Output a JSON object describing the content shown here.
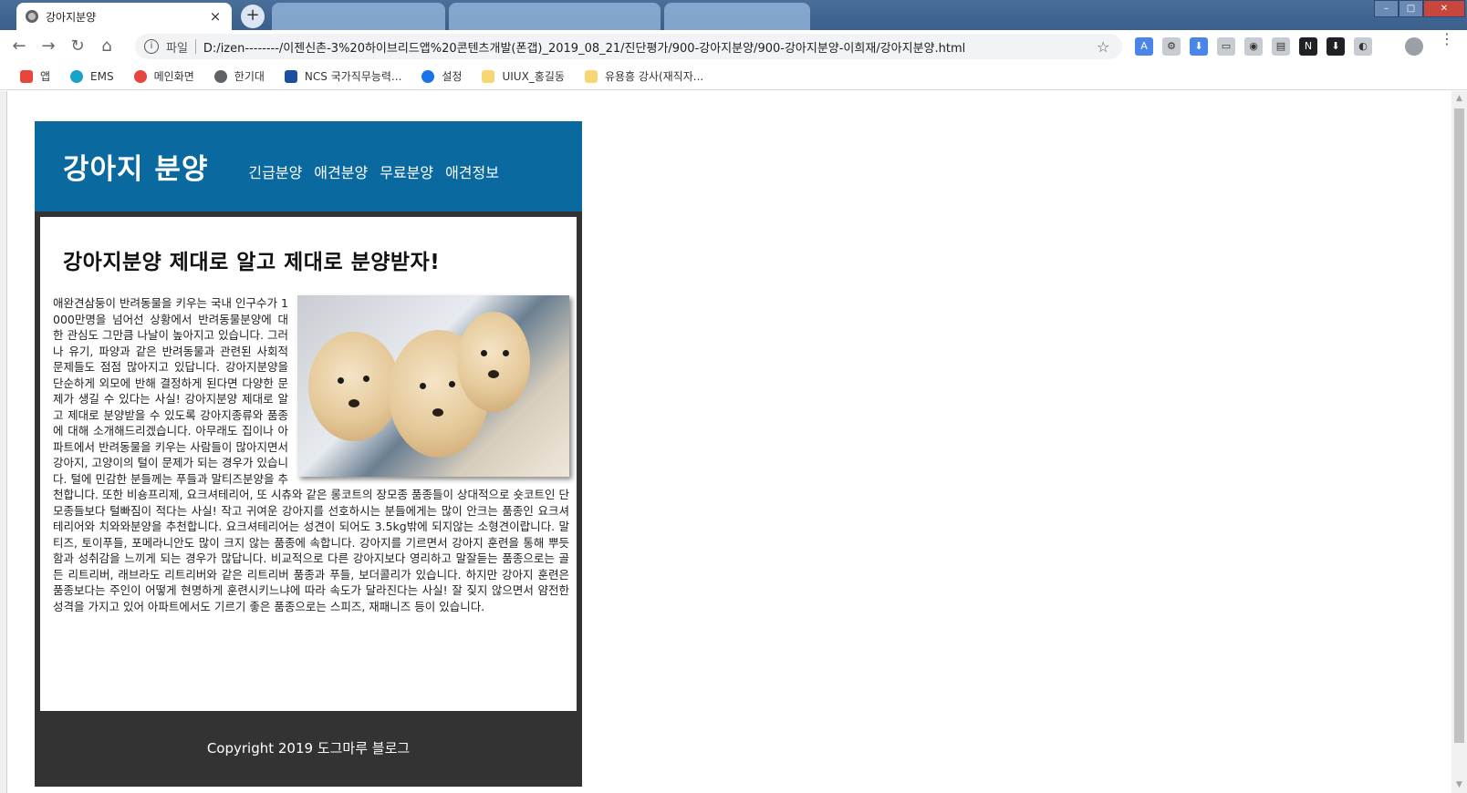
{
  "browser": {
    "active_tab": {
      "title": "강아지분양",
      "close": "×"
    },
    "new_tab": "+",
    "window_controls": {
      "minimize": "–",
      "maximize": "□",
      "close": "✕"
    },
    "nav": {
      "back": "←",
      "forward": "→",
      "reload": "↻",
      "home": "⌂"
    },
    "omnibox": {
      "info": "i",
      "scheme": "파일",
      "url": "D:/izen--------/이젠신촌-3%20하이브리드앱%20콘텐츠개발(폰갭)_2019_08_21/진단평가/900-강아지분양/900-강아지분양-이희재/강아지분양.html",
      "star": "☆"
    },
    "extensions": [
      "A",
      "⚙",
      "⬇",
      "▭",
      "◉",
      "▤",
      "N",
      "⬇",
      "◐"
    ],
    "bookmarks": [
      {
        "label": "앱",
        "icon": "apps-grid-icon",
        "color": "#e8453c"
      },
      {
        "label": "EMS",
        "icon": "ems-icon",
        "color": "#1aa3c9"
      },
      {
        "label": "메인화면",
        "icon": "main-icon",
        "color": "#e8453c"
      },
      {
        "label": "한기대",
        "icon": "globe-icon",
        "color": "#5f6368"
      },
      {
        "label": "NCS 국가직무능력...",
        "icon": "ncs-icon",
        "color": "#1a4fa0"
      },
      {
        "label": "설정",
        "icon": "gear-icon",
        "color": "#1a73e8"
      },
      {
        "label": "UIUX_홍길동",
        "icon": "folder-icon",
        "color": "#f7d774"
      },
      {
        "label": "유용흥 강사(재직자...",
        "icon": "folder-icon",
        "color": "#f7d774"
      }
    ]
  },
  "site": {
    "logo": "강아지 분양",
    "nav": [
      "긴급분양",
      "애견분양",
      "무료분양",
      "애견정보"
    ],
    "article": {
      "title": "강아지분양 제대로 알고 제대로 분양받자!",
      "body": "애완견삼둥이 반려동물을 키우는 국내 인구수가 1000만명을 넘어선 상황에서 반려동물분양에 대한 관심도 그만큼 나날이 높아지고 있습니다. 그러나 유기, 파양과 같은 반려동물과 관련된 사회적 문제들도 점점 많아지고 있답니다. 강아지분양을 단순하게 외모에 반해 결정하게 된다면 다양한 문제가 생길 수 있다는 사실! 강아지분양 제대로 알고 제대로 분양받을 수 있도록 강아지종류와 품종에 대해 소개해드리겠습니다. 아무래도 집이나 아파트에서 반려동물을 키우는 사람들이 많아지면서 강아지, 고양이의 털이 문제가 되는 경우가 있습니다. 털에 민감한 분들께는 푸들과 말티즈분양을 추천합니다. 또한 비숑프리제, 요크셔테리어, 또 시츄와 같은 롱코트의 장모종 품종들이 상대적으로 숏코트인 단모종들보다 털빠짐이 적다는 사실! 작고 귀여운 강아지를 선호하시는 분들에게는 많이 안크는 품종인 요크셔테리어와 치와와분양을 추천합니다. 요크셔테리어는 성견이 되어도 3.5kg밖에 되지않는 소형견이랍니다. 말티즈, 토이푸들, 포메라니안도 많이 크지 않는 품종에 속합니다. 강아지를 기르면서 강아지 훈련을 통해 뿌듯함과 성취감을 느끼게 되는 경우가 많답니다. 비교적으로 다른 강아지보다 영리하고 말잘듣는 품종으로는 골든 리트리버, 래브라도 리트리버와 같은 리트리버 품종과 푸들, 보더콜리가 있습니다. 하지만 강아지 훈련은 품종보다는 주인이 어떻게 현명하게 훈련시키느냐에 따라 속도가 달라진다는 사실! 잘 짖지 않으면서 얌전한 성격을 가지고 있어 아파트에서도 기르기 좋은 품종으로는 스피즈, 재패니즈 등이 있습니다."
    },
    "footer": "Copyright 2019 도그마루 블로그"
  }
}
